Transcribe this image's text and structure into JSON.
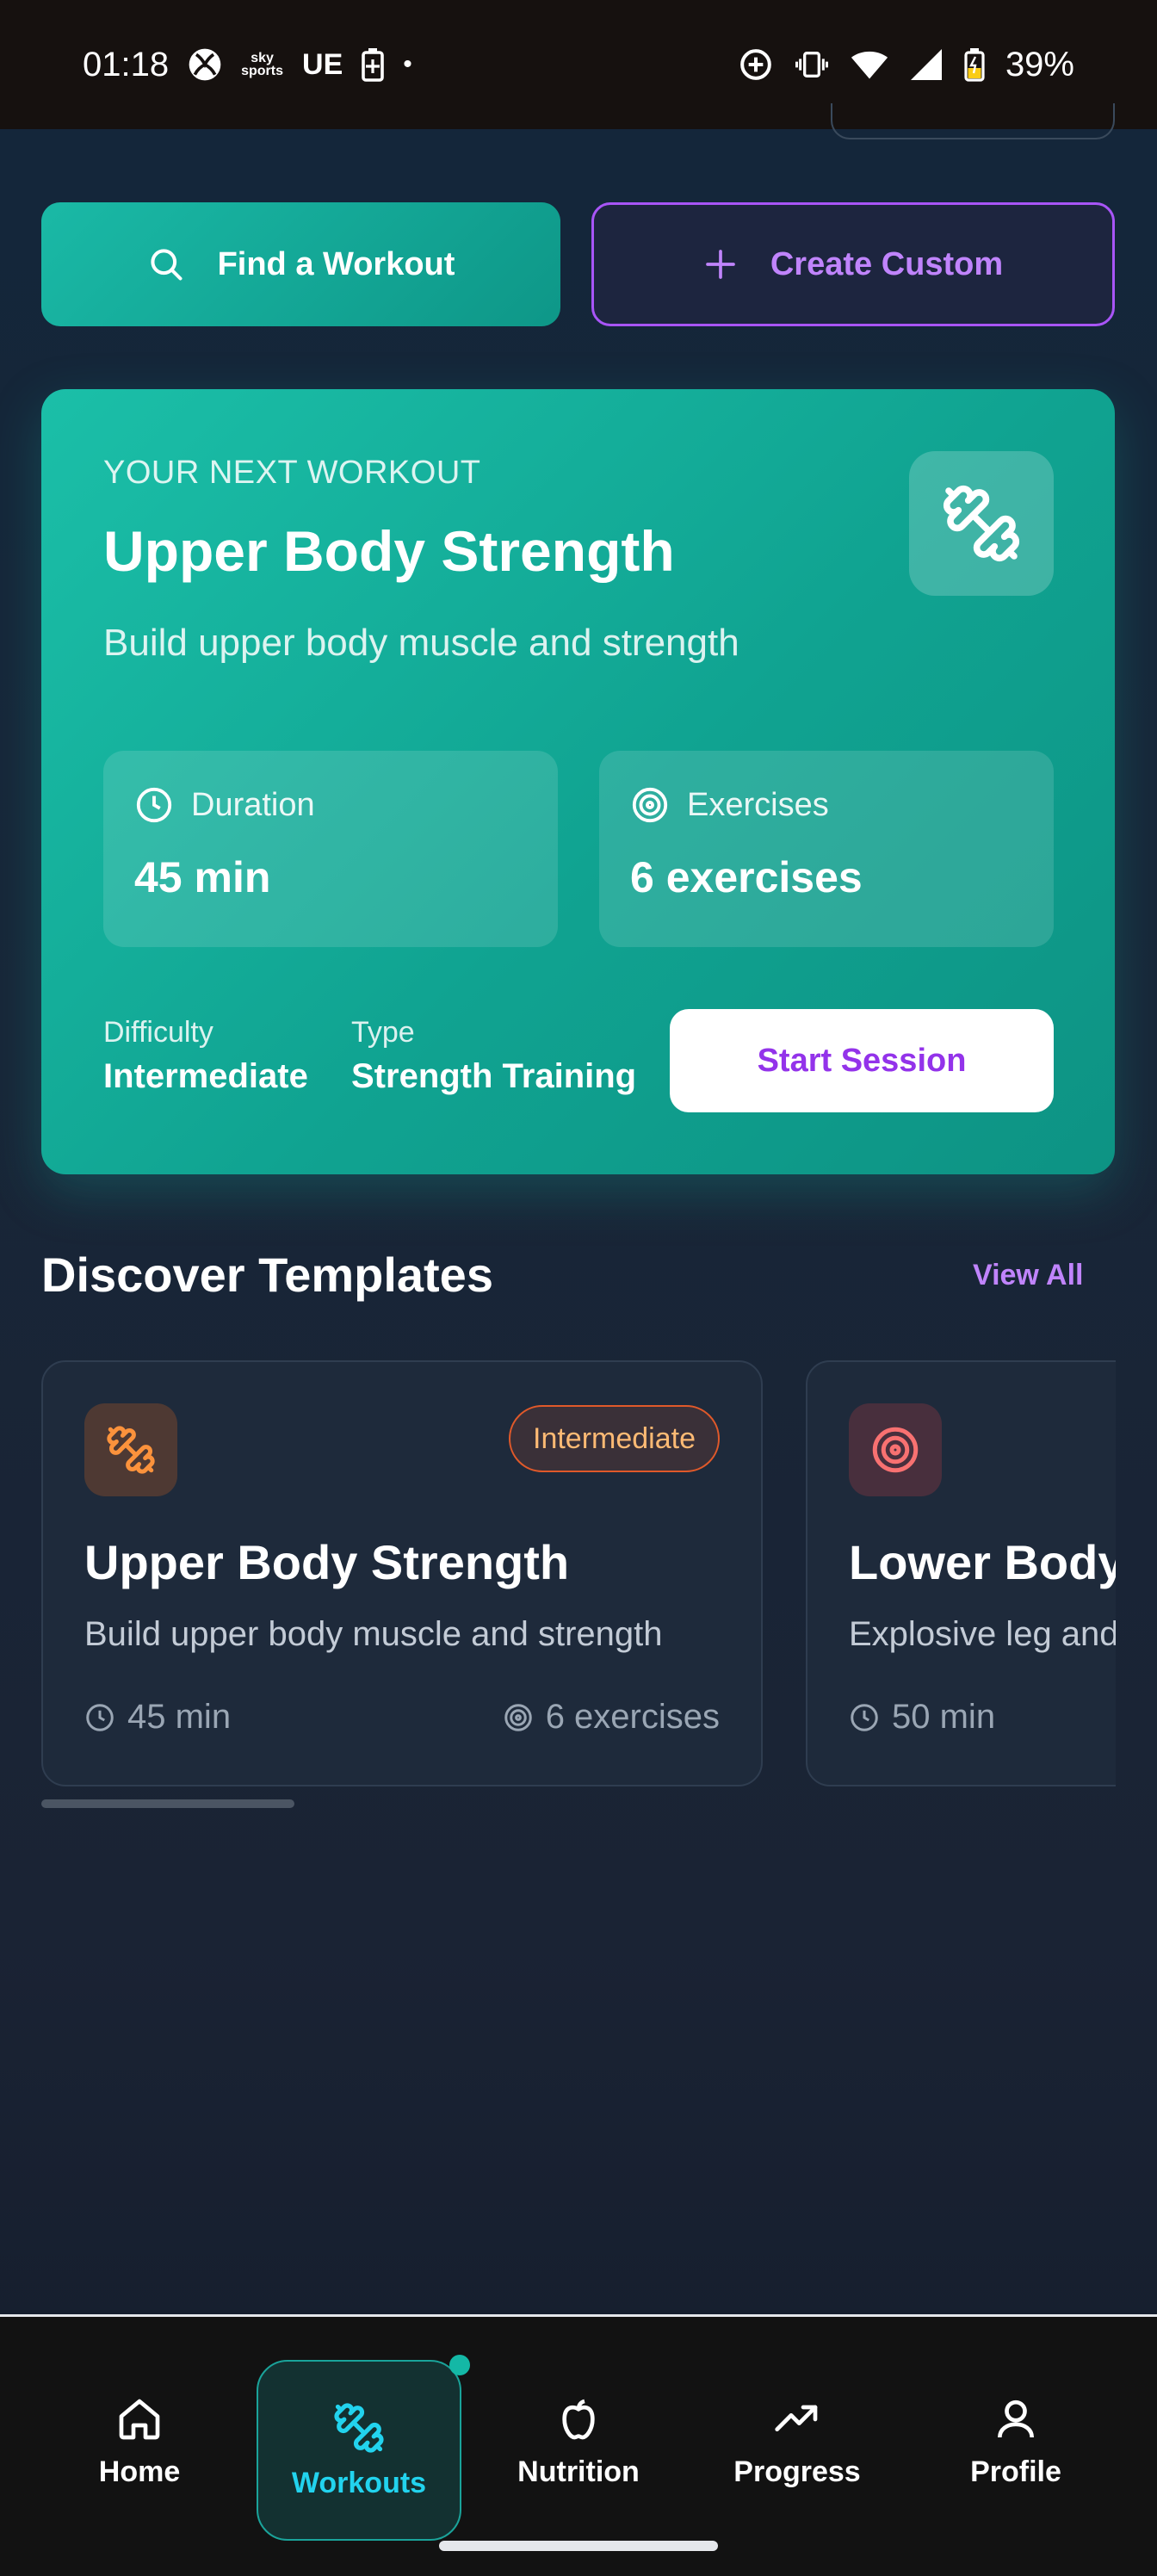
{
  "status_bar": {
    "time": "01:18",
    "carrier_icons": [
      "xbox-icon",
      "sky-sports-icon",
      "ue-icon",
      "battery-saver-icon"
    ],
    "sky_line1": "sky",
    "sky_line2": "sports",
    "ue_label": "UE",
    "dot": "•",
    "battery_percent": "39%"
  },
  "actions": {
    "find_label": "Find a Workout",
    "create_label": "Create Custom"
  },
  "next_workout": {
    "eyebrow": "YOUR NEXT WORKOUT",
    "title": "Upper Body Strength",
    "description": "Build upper body muscle and strength",
    "duration_label": "Duration",
    "duration_value": "45 min",
    "exercises_label": "Exercises",
    "exercises_value": "6 exercises",
    "difficulty_label": "Difficulty",
    "difficulty_value": "Intermediate",
    "type_label": "Type",
    "type_value": "Strength Training",
    "start_label": "Start Session"
  },
  "discover": {
    "title": "Discover Templates",
    "view_all": "View All",
    "templates": [
      {
        "title": "Upper Body Strength",
        "description": "Build upper body muscle and strength",
        "badge": "Intermediate",
        "duration": "45 min",
        "exercises": "6 exercises",
        "icon": "dumbbell-icon",
        "accent": "#f97316"
      },
      {
        "title": "Lower Body Power",
        "description": "Explosive leg and glute workout",
        "duration": "50 min",
        "icon": "target-icon",
        "accent": "#ef4444"
      }
    ]
  },
  "nav": {
    "home": "Home",
    "workouts": "Workouts",
    "nutrition": "Nutrition",
    "progress": "Progress",
    "profile": "Profile",
    "active": "workouts"
  },
  "colors": {
    "accent_teal": "#14b8a6",
    "accent_purple": "#a855f7",
    "card_bg": "#1e2a3b"
  }
}
